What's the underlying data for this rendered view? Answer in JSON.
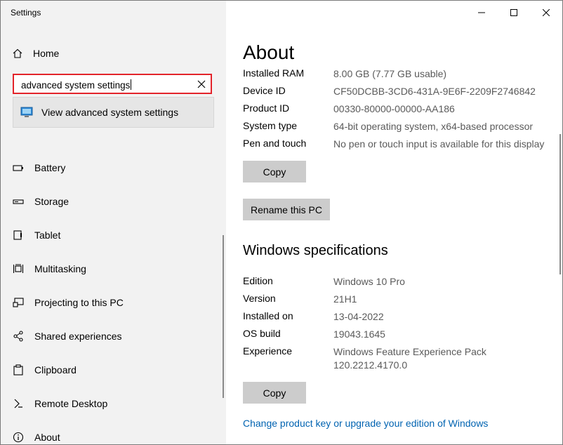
{
  "window": {
    "title": "Settings"
  },
  "sidebar": {
    "home_label": "Home",
    "search": {
      "value": "advanced system settings"
    },
    "suggestion": {
      "label": "View advanced system settings"
    },
    "items": [
      {
        "label": "Battery",
        "icon": "battery-icon"
      },
      {
        "label": "Storage",
        "icon": "storage-icon"
      },
      {
        "label": "Tablet",
        "icon": "tablet-icon"
      },
      {
        "label": "Multitasking",
        "icon": "multitasking-icon"
      },
      {
        "label": "Projecting to this PC",
        "icon": "projecting-icon"
      },
      {
        "label": "Shared experiences",
        "icon": "shared-experiences-icon"
      },
      {
        "label": "Clipboard",
        "icon": "clipboard-icon"
      },
      {
        "label": "Remote Desktop",
        "icon": "remote-desktop-icon"
      },
      {
        "label": "About",
        "icon": "info-icon"
      }
    ]
  },
  "about": {
    "title": "About",
    "device_specs": [
      {
        "label": "Installed RAM",
        "value": "8.00 GB (7.77 GB usable)"
      },
      {
        "label": "Device ID",
        "value": "CF50DCBB-3CD6-431A-9E6F-2209F2746842"
      },
      {
        "label": "Product ID",
        "value": "00330-80000-00000-AA186"
      },
      {
        "label": "System type",
        "value": "64-bit operating system, x64-based processor"
      },
      {
        "label": "Pen and touch",
        "value": "No pen or touch input is available for this display"
      }
    ],
    "copy_label": "Copy",
    "rename_label": "Rename this PC",
    "windows_specs_title": "Windows specifications",
    "windows_specs": [
      {
        "label": "Edition",
        "value": "Windows 10 Pro"
      },
      {
        "label": "Version",
        "value": "21H1"
      },
      {
        "label": "Installed on",
        "value": "13-04-2022"
      },
      {
        "label": "OS build",
        "value": "19043.1645"
      },
      {
        "label": "Experience",
        "value": "Windows Feature Experience Pack 120.2212.4170.0"
      }
    ],
    "copy2_label": "Copy",
    "link_label": "Change product key or upgrade your edition of Windows"
  }
}
